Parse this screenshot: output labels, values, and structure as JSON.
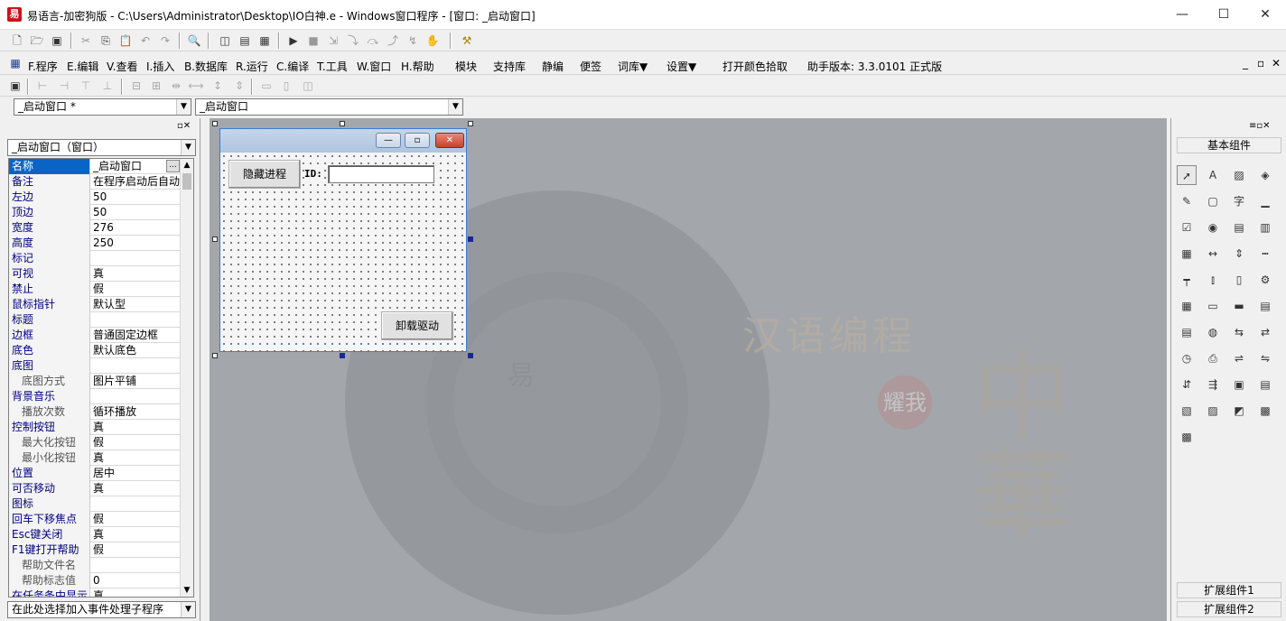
{
  "window": {
    "title": "易语言-加密狗版 - C:\\Users\\Administrator\\Desktop\\IO白神.e - Windows窗口程序 - [窗口: _启动窗口]",
    "app_icon": "易",
    "minimize": "—",
    "maximize": "☐",
    "close": "✕"
  },
  "menu": {
    "items": [
      "F.程序",
      "E.编辑",
      "V.查看",
      "I.插入",
      "B.数据库",
      "R.运行",
      "C.编译",
      "T.工具",
      "W.窗口",
      "H.帮助",
      "模块",
      "支持库",
      "静编",
      "便签",
      "词库▼",
      "设置▼",
      "打开颜色拾取",
      "助手版本: 3.3.0101 正式版"
    ],
    "mdi_controls": [
      "_",
      "▫",
      "✕"
    ]
  },
  "selectors": {
    "window_combo": "_启动窗口 *",
    "object_combo": "_启动窗口",
    "prop_object_combo": "_启动窗口（窗口）",
    "event_combo": "在此处选择加入事件处理子程序"
  },
  "properties": [
    {
      "name": "名称",
      "value": "_启动窗口",
      "selected": true,
      "sub": false
    },
    {
      "name": "备注",
      "value": "在程序启动后自动",
      "sub": false
    },
    {
      "name": "左边",
      "value": "50",
      "sub": false
    },
    {
      "name": "顶边",
      "value": "50",
      "sub": false
    },
    {
      "name": "宽度",
      "value": "276",
      "sub": false
    },
    {
      "name": "高度",
      "value": "250",
      "sub": false
    },
    {
      "name": "标记",
      "value": "",
      "sub": false
    },
    {
      "name": "可视",
      "value": "真",
      "sub": false
    },
    {
      "name": "禁止",
      "value": "假",
      "sub": false
    },
    {
      "name": "鼠标指针",
      "value": "默认型",
      "sub": false
    },
    {
      "name": "标题",
      "value": "",
      "sub": false
    },
    {
      "name": "边框",
      "value": "普通固定边框",
      "sub": false
    },
    {
      "name": "底色",
      "value": "默认底色",
      "sub": false
    },
    {
      "name": "底图",
      "value": "",
      "sub": false
    },
    {
      "name": "底图方式",
      "value": "图片平铺",
      "sub": true
    },
    {
      "name": "背景音乐",
      "value": "",
      "sub": false
    },
    {
      "name": "播放次数",
      "value": "循环播放",
      "sub": true
    },
    {
      "name": "控制按钮",
      "value": "真",
      "sub": false
    },
    {
      "name": "最大化按钮",
      "value": "假",
      "sub": true
    },
    {
      "name": "最小化按钮",
      "value": "真",
      "sub": true
    },
    {
      "name": "位置",
      "value": "居中",
      "sub": false
    },
    {
      "name": "可否移动",
      "value": "真",
      "sub": false
    },
    {
      "name": "图标",
      "value": "",
      "sub": false
    },
    {
      "name": "回车下移焦点",
      "value": "假",
      "sub": false
    },
    {
      "name": "Esc键关闭",
      "value": "真",
      "sub": false
    },
    {
      "name": "F1键打开帮助",
      "value": "假",
      "sub": false
    },
    {
      "name": "帮助文件名",
      "value": "",
      "sub": true
    },
    {
      "name": "帮助标志值",
      "value": "0",
      "sub": true
    },
    {
      "name": "在任务条中显示",
      "value": "真",
      "sub": false
    }
  ],
  "prop_value_button": "...",
  "form": {
    "hide_button": "隐藏进程",
    "id_label": "ID:",
    "id_value": "",
    "unload_button": "卸载驱动",
    "min_btn": "—",
    "max_btn": "▫",
    "close_btn": "✕"
  },
  "watermark": {
    "title": "汉语编程",
    "big": "中華",
    "seal": "耀我",
    "circle_char": "易"
  },
  "components": {
    "basic": "基本组件",
    "ext1": "扩展组件1",
    "ext2": "扩展组件2",
    "icons": [
      "pointer-icon",
      "label-icon",
      "picture-icon",
      "shape-icon",
      "edit-icon",
      "groupbox-icon",
      "text-icon",
      "line-icon",
      "checkbox-icon",
      "radio-icon",
      "listbox-icon",
      "combobox-icon",
      "table-icon",
      "slider-icon",
      "spin-icon",
      "scrollbar-icon",
      "ruler-icon",
      "tabstop-icon",
      "dialog-icon",
      "gear-icon",
      "grid-icon",
      "button-icon",
      "folder-icon",
      "doc-icon",
      "report-icon",
      "globe-icon",
      "tree-icon",
      "menu-icon",
      "timer-icon",
      "printer-icon",
      "net-icon",
      "net2-icon",
      "server-icon",
      "pipe-icon",
      "window-icon",
      "list-icon",
      "db-icon",
      "db2-icon",
      "chart-icon",
      "odbc-icon",
      "odbc2-icon"
    ]
  }
}
